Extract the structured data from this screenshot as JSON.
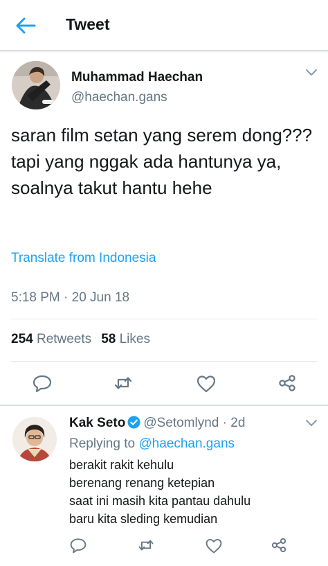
{
  "header": {
    "title": "Tweet",
    "back_icon": "arrow-left-icon"
  },
  "tweet": {
    "author_name": "Muhammad Haechan",
    "author_handle": "@haechan.gans",
    "text": "saran film setan yang serem dong??? tapi yang nggak ada hantunya ya, soalnya takut hantu hehe",
    "translate_label": "Translate from Indonesia",
    "timestamp": "5:18 PM · 20 Jun 18",
    "retweets_count": "254",
    "retweets_label": "Retweets",
    "likes_count": "58",
    "likes_label": "Likes",
    "actions": [
      "reply-icon",
      "retweet-icon",
      "like-icon",
      "share-icon"
    ]
  },
  "reply": {
    "author_name": "Kak Seto",
    "verified": true,
    "author_handle": "@Setomlynd",
    "age": "· 2d",
    "replying_prefix": "Replying to",
    "replying_to": "@haechan.gans",
    "lines": [
      "berakit rakit kehulu",
      "berenang renang ketepian",
      "saat ini masih kita pantau dahulu",
      "baru kita sleding kemudian"
    ],
    "actions": [
      "reply-icon",
      "retweet-icon",
      "like-icon",
      "share-icon"
    ]
  },
  "colors": {
    "accent": "#1da1f2",
    "secondary_text": "#657786",
    "primary_text": "#14171a",
    "divider": "#e1e8ed"
  }
}
